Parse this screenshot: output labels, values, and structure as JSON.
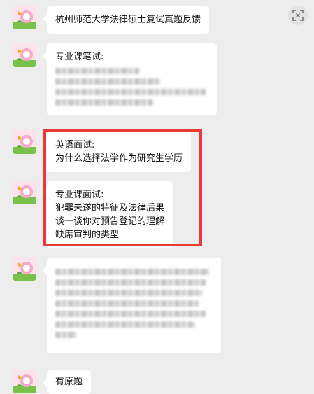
{
  "toolbar": {
    "scan_icon": "scan-icon"
  },
  "messages": [
    {
      "lines": [
        "杭州师范大学法律硕士复试真题反馈"
      ]
    },
    {
      "lines": [
        "专业课笔试:"
      ]
    },
    {
      "lines": [
        "英语面试:",
        "为什么选择法学作为研究生学历"
      ]
    },
    {
      "lines": [
        "专业课面试:",
        "犯罪未遂的特征及法律后果",
        "谈一谈你对预告登记的理解",
        "缺席审判的类型"
      ]
    },
    {
      "lines": []
    },
    {
      "lines": [
        "有原题"
      ]
    }
  ],
  "colors": {
    "background": "#ededed",
    "bubble": "#ffffff",
    "highlight": "#e93a3a"
  }
}
